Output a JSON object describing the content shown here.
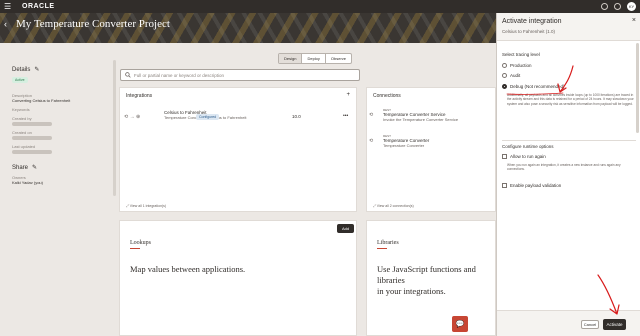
{
  "topbar": {
    "brand": "ORACLE",
    "avatar_initials": "KY"
  },
  "project": {
    "title": "My Temperature Converter Project"
  },
  "details": {
    "heading": "Details",
    "status": "Active",
    "description_label": "Description",
    "description_value": "Converting Celsius to Fahrenheit",
    "keywords_label": "Keywords",
    "created_by_label": "Created by",
    "created_on_label": "Created on",
    "last_updated_label": "Last updated",
    "share_heading": "Share",
    "owners_label": "Owners",
    "owners_value": "Kalki Yadav (you)"
  },
  "view_tabs": [
    "Design",
    "Deploy",
    "Observe"
  ],
  "search": {
    "placeholder": "Full or partial name or keyword or description"
  },
  "integrations": {
    "title": "Integrations",
    "add_icon": "+",
    "item_name": "Celsius to Fahrenheit",
    "item_desc": "Temperature Converter · Celsius to Fahrenheit",
    "item_version": "10.0",
    "item_status": "Configured",
    "more": "•••",
    "footer": "View all 1 integration(s)"
  },
  "connections": {
    "title": "Connections",
    "rows": [
      {
        "tag": "REST",
        "name": "Temperature Converter Service",
        "desc": "Invoke the Temperature Converter Service"
      },
      {
        "tag": "REST",
        "name": "Temperature Converter",
        "desc": "Temperature Converter"
      }
    ],
    "footer": "View all 2 connection(s)"
  },
  "lookups": {
    "title": "Lookups",
    "add_label": "Add",
    "text": "Map values between applications."
  },
  "libraries": {
    "title": "Libraries",
    "text_line1": "Use JavaScript functions and libraries",
    "text_line2": "in your integrations."
  },
  "drawer": {
    "title": "Activate integration",
    "subtitle": "Celsius to Fahrenheit (1.0)",
    "close": "×",
    "tracing_label": "Select tracing level",
    "options": [
      "Production",
      "Audit",
      "Debug (Not recommended)"
    ],
    "selected": "Debug (Not recommended)",
    "debug_help": "Additionally, all payloads and all activities inside loops (up to 1000 iterations) are traced in the activity stream and this data is retained for a period of 24 hours. It may slowdown your system and also pose a security risk as sensitive information from payload will be logged.",
    "runtime_label": "Configure runtime options",
    "allow_rerun": "Allow to run again",
    "allow_rerun_help": "When you run again an integration, it creates a new instance and runs again any connections.",
    "payload_validation": "Enable payload validation",
    "cancel": "Cancel",
    "activate": "Activate"
  },
  "colors": {
    "accent": "#c74634",
    "dark": "#312d2a",
    "annotation": "#d81b1b"
  },
  "icons": {
    "menu": "hamburger-icon",
    "feedback": "chat-icon"
  }
}
